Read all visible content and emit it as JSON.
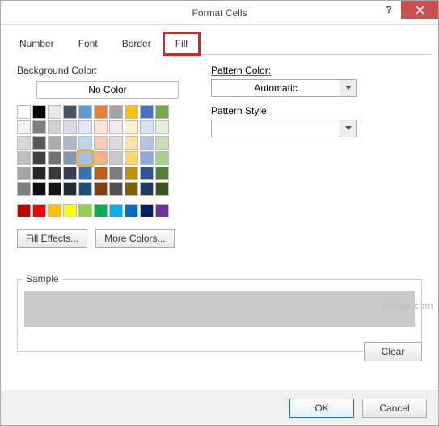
{
  "window": {
    "title": "Format Cells"
  },
  "tabs": [
    "Number",
    "Font",
    "Border",
    "Fill"
  ],
  "active_tab": "Fill",
  "fill": {
    "bg_color_label": "Background Color:",
    "no_color": "No Color",
    "fill_effects": "Fill Effects...",
    "more_colors": "More Colors...",
    "theme_colors": [
      [
        "#ffffff",
        "#000000",
        "#e7e6e6",
        "#44546a",
        "#5b9bd5",
        "#ed7d31",
        "#a5a5a5",
        "#ffc000",
        "#4472c4",
        "#70ad47"
      ],
      [
        "#f2f2f2",
        "#7f7f7f",
        "#d0cece",
        "#d6dce4",
        "#deebf6",
        "#fbe5d5",
        "#ededed",
        "#fff2cc",
        "#d9e2f3",
        "#e2efd9"
      ],
      [
        "#d8d8d8",
        "#595959",
        "#aeabab",
        "#adb9ca",
        "#bdd7ee",
        "#f7cbac",
        "#dbdbdb",
        "#fee599",
        "#b4c6e7",
        "#c5e0b3"
      ],
      [
        "#bfbfbf",
        "#3f3f3f",
        "#757070",
        "#8496b0",
        "#9cc3e5",
        "#f4b183",
        "#c9c9c9",
        "#ffd965",
        "#8eaadb",
        "#a8d08d"
      ],
      [
        "#a5a5a5",
        "#262626",
        "#3a3838",
        "#323f4f",
        "#2e75b5",
        "#c55a11",
        "#7b7b7b",
        "#bf9000",
        "#2f5496",
        "#538135"
      ],
      [
        "#7f7f7f",
        "#0c0c0c",
        "#171616",
        "#222a35",
        "#1e4e79",
        "#833c0b",
        "#525252",
        "#7f6000",
        "#1f3864",
        "#375623"
      ]
    ],
    "standard_colors": [
      "#c00000",
      "#ff0000",
      "#ffc000",
      "#ffff00",
      "#92d050",
      "#00b050",
      "#00b0f0",
      "#0070c0",
      "#002060",
      "#7030a0"
    ],
    "selected": [
      3,
      4
    ]
  },
  "pattern": {
    "color_label": "Pattern Color:",
    "color_value": "Automatic",
    "style_label": "Pattern Style:"
  },
  "sample_label": "Sample",
  "clear_label": "Clear",
  "ok": "OK",
  "cancel": "Cancel",
  "watermark": "wsxdn.com"
}
